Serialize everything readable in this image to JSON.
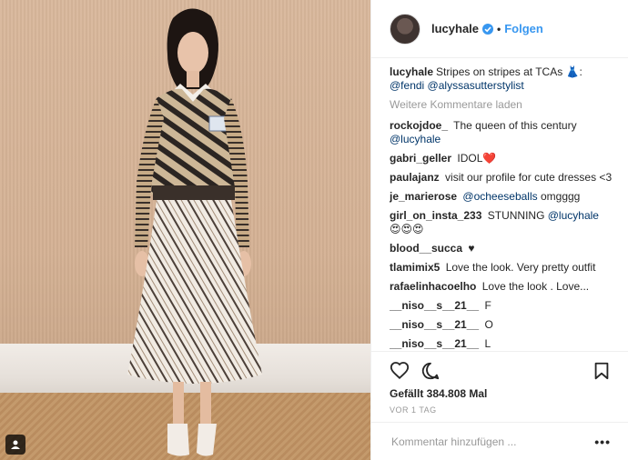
{
  "header": {
    "username": "lucyhale",
    "dot": "•",
    "follow_label": "Folgen"
  },
  "caption": {
    "username": "lucyhale",
    "text": "Stripes on stripes at TCAs",
    "emoji": "👗",
    "colon": ":",
    "mention1": "@fendi",
    "mention2": "@alyssasutterstylist"
  },
  "load_more": "Weitere Kommentare laden",
  "comments": [
    {
      "user": "rockojdoe_",
      "text": "The queen of this century",
      "mention": "@lucyhale"
    },
    {
      "user": "gabri_geller",
      "text": "IDOL",
      "emoji": "❤️"
    },
    {
      "user": "paulajanz",
      "text": "visit our profile for cute dresses <3"
    },
    {
      "user": "je_marierose",
      "mention": "@ocheeseballs",
      "text": "omgggg"
    },
    {
      "user": "girl_on_insta_233",
      "text": "STUNNING",
      "mention": "@lucyhale",
      "emoji": "😍😍😍"
    },
    {
      "user": "blood__succa",
      "text": "♥"
    },
    {
      "user": "tlamimix5",
      "text": "Love the look. Very pretty outfit"
    },
    {
      "user": "rafaelinhacoelho",
      "text": "Love the look . Love..."
    },
    {
      "user": "__niso__s__21__",
      "text": "F"
    },
    {
      "user": "__niso__s__21__",
      "text": "O"
    },
    {
      "user": "__niso__s__21__",
      "text": "L"
    }
  ],
  "likes": "Gefällt 384.808 Mal",
  "time": "VOR 1 TAG",
  "add_comment": {
    "placeholder": "Kommentar hinzufügen ..."
  },
  "more_options": "•••",
  "icons": {
    "like": "heart-icon",
    "comment": "comment-icon",
    "save": "bookmark-icon",
    "verified": "verified-badge-icon",
    "user_tag": "user-tag-icon"
  },
  "colors": {
    "accent": "#3897f0",
    "mention": "#003569",
    "muted": "#999999"
  }
}
